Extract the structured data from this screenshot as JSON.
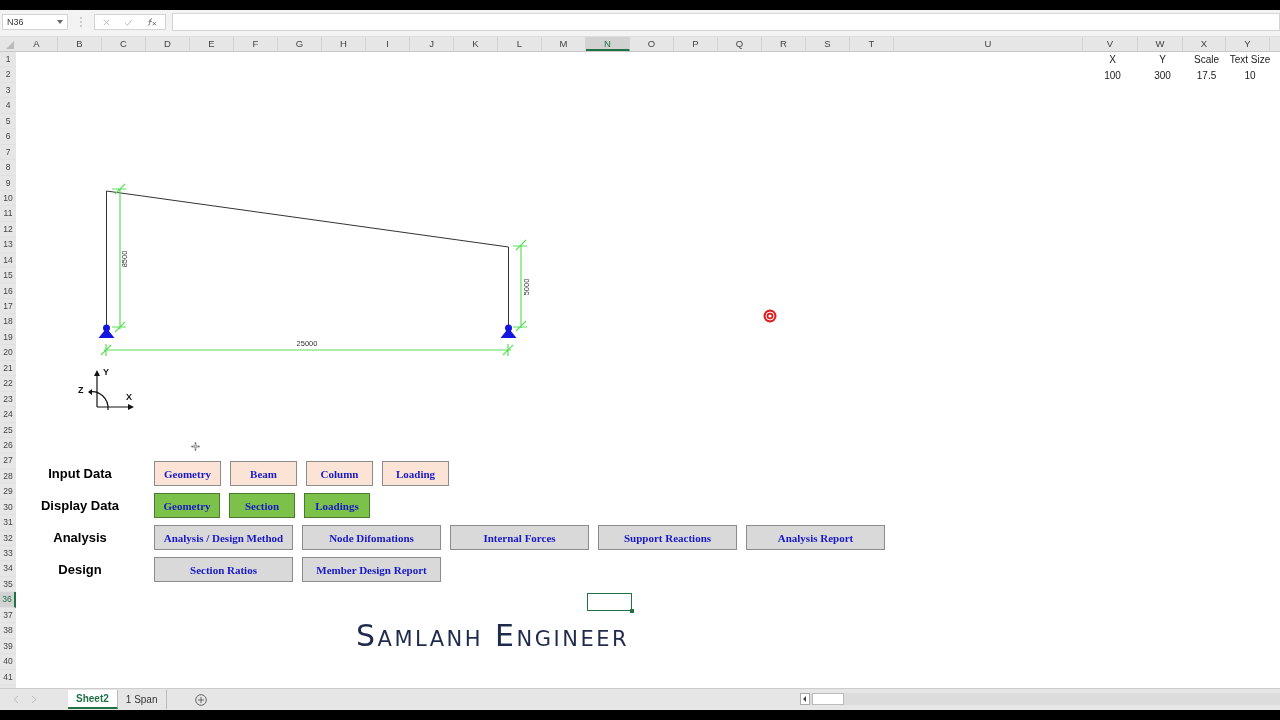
{
  "formula_bar": {
    "name_box": "N36"
  },
  "columns": [
    {
      "label": "A",
      "selected": false
    },
    {
      "label": "B",
      "selected": false
    },
    {
      "label": "C",
      "selected": false
    },
    {
      "label": "D",
      "selected": false
    },
    {
      "label": "E",
      "selected": false
    },
    {
      "label": "F",
      "selected": false
    },
    {
      "label": "G",
      "selected": false
    },
    {
      "label": "H",
      "selected": false
    },
    {
      "label": "I",
      "selected": false
    },
    {
      "label": "J",
      "selected": false
    },
    {
      "label": "K",
      "selected": false
    },
    {
      "label": "L",
      "selected": false
    },
    {
      "label": "M",
      "selected": false
    },
    {
      "label": "N",
      "selected": true
    },
    {
      "label": "O",
      "selected": false
    },
    {
      "label": "P",
      "selected": false
    },
    {
      "label": "Q",
      "selected": false
    },
    {
      "label": "R",
      "selected": false
    },
    {
      "label": "S",
      "selected": false
    },
    {
      "label": "T",
      "selected": false
    },
    {
      "label": "U",
      "selected": false
    },
    {
      "label": "V",
      "selected": false
    },
    {
      "label": "W",
      "selected": false
    },
    {
      "label": "X",
      "selected": false
    },
    {
      "label": "Y",
      "selected": false
    }
  ],
  "rows": [
    {
      "label": "1",
      "selected": false
    },
    {
      "label": "2",
      "selected": false
    },
    {
      "label": "3",
      "selected": false
    },
    {
      "label": "4",
      "selected": false
    },
    {
      "label": "5",
      "selected": false
    },
    {
      "label": "6",
      "selected": false
    },
    {
      "label": "7",
      "selected": false
    },
    {
      "label": "8",
      "selected": false
    },
    {
      "label": "9",
      "selected": false
    },
    {
      "label": "10",
      "selected": false
    },
    {
      "label": "11",
      "selected": false
    },
    {
      "label": "12",
      "selected": false
    },
    {
      "label": "13",
      "selected": false
    },
    {
      "label": "14",
      "selected": false
    },
    {
      "label": "15",
      "selected": false
    },
    {
      "label": "16",
      "selected": false
    },
    {
      "label": "17",
      "selected": false
    },
    {
      "label": "18",
      "selected": false
    },
    {
      "label": "19",
      "selected": false
    },
    {
      "label": "20",
      "selected": false
    },
    {
      "label": "21",
      "selected": false
    },
    {
      "label": "22",
      "selected": false
    },
    {
      "label": "23",
      "selected": false
    },
    {
      "label": "24",
      "selected": false
    },
    {
      "label": "25",
      "selected": false
    },
    {
      "label": "26",
      "selected": false
    },
    {
      "label": "27",
      "selected": false
    },
    {
      "label": "28",
      "selected": false
    },
    {
      "label": "29",
      "selected": false
    },
    {
      "label": "30",
      "selected": false
    },
    {
      "label": "31",
      "selected": false
    },
    {
      "label": "32",
      "selected": false
    },
    {
      "label": "33",
      "selected": false
    },
    {
      "label": "34",
      "selected": false
    },
    {
      "label": "35",
      "selected": false
    },
    {
      "label": "36",
      "selected": true
    },
    {
      "label": "37",
      "selected": false
    },
    {
      "label": "38",
      "selected": false
    },
    {
      "label": "39",
      "selected": false
    },
    {
      "label": "40",
      "selected": false
    },
    {
      "label": "41",
      "selected": false
    }
  ],
  "parameter_table": {
    "headers": [
      "X",
      "Y",
      "Scale",
      "Text Size"
    ],
    "values": [
      "100",
      "300",
      "17.5",
      "10"
    ]
  },
  "frame_drawing": {
    "dimension_labels": [
      "8500",
      "5000",
      "25000"
    ],
    "axis_labels": [
      "Y",
      "X",
      "Z"
    ]
  },
  "control_rows": [
    {
      "label": "Input Data",
      "kind": "input",
      "buttons": [
        "Geometry",
        "Beam",
        "Column",
        "Loading"
      ]
    },
    {
      "label": "Display Data",
      "kind": "display",
      "buttons": [
        "Geometry",
        "Section",
        "Loadings"
      ]
    },
    {
      "label": "Analysis",
      "kind": "command",
      "buttons": [
        "Analysis / Design Method",
        "Node Difomations",
        "Internal Forces",
        "Support Reactions",
        "Analysis Report"
      ]
    },
    {
      "label": "Design",
      "kind": "command",
      "buttons": [
        "Section Ratios",
        "Member Design Report"
      ]
    }
  ],
  "brand": "Samlanh Engineer",
  "sheet_tabs": [
    {
      "label": "Sheet2",
      "selected": true
    },
    {
      "label": "1 Span",
      "selected": false
    }
  ]
}
